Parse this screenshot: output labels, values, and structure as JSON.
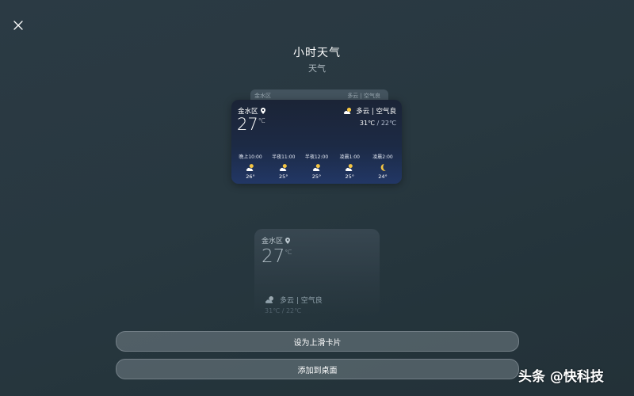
{
  "header": {
    "close_icon": "close-icon",
    "title": "小时天气",
    "subtitle": "天气"
  },
  "ghost_card": {
    "location": "金水区",
    "condition": "多云 | 空气良"
  },
  "weather_card": {
    "location": "金水区",
    "location_icon": "location-pin-icon",
    "temperature": "27",
    "temp_unit": "℃",
    "condition_icon": "partly-cloudy-icon",
    "condition": "多云 | 空气良",
    "high": "31℃",
    "separator": " / ",
    "low": "22℃",
    "hours": [
      {
        "time": "晚上10:00",
        "icon": "partly-cloudy-night-icon",
        "temp": "26°"
      },
      {
        "time": "半夜11:00",
        "icon": "partly-cloudy-night-icon",
        "temp": "25°"
      },
      {
        "time": "半夜12:00",
        "icon": "partly-cloudy-night-icon",
        "temp": "25°"
      },
      {
        "time": "凌晨1:00",
        "icon": "partly-cloudy-night-icon",
        "temp": "25°"
      },
      {
        "time": "凌晨2:00",
        "icon": "crescent-moon-icon",
        "temp": "24°"
      }
    ]
  },
  "preview_card": {
    "location": "金水区",
    "temperature": "27",
    "temp_unit": "℃",
    "condition": "多云 | 空气良",
    "range": "31℃ / 22℃"
  },
  "buttons": {
    "set_swipe_up_card": "设为上滑卡片",
    "add_to_desktop": "添加到桌面"
  },
  "watermark": "头条 @快科技",
  "colors": {
    "background": "#283840",
    "card_top": "#1b2436",
    "card_bottom": "#223765",
    "moon": "#f5c542",
    "button": "#8c98a0"
  }
}
